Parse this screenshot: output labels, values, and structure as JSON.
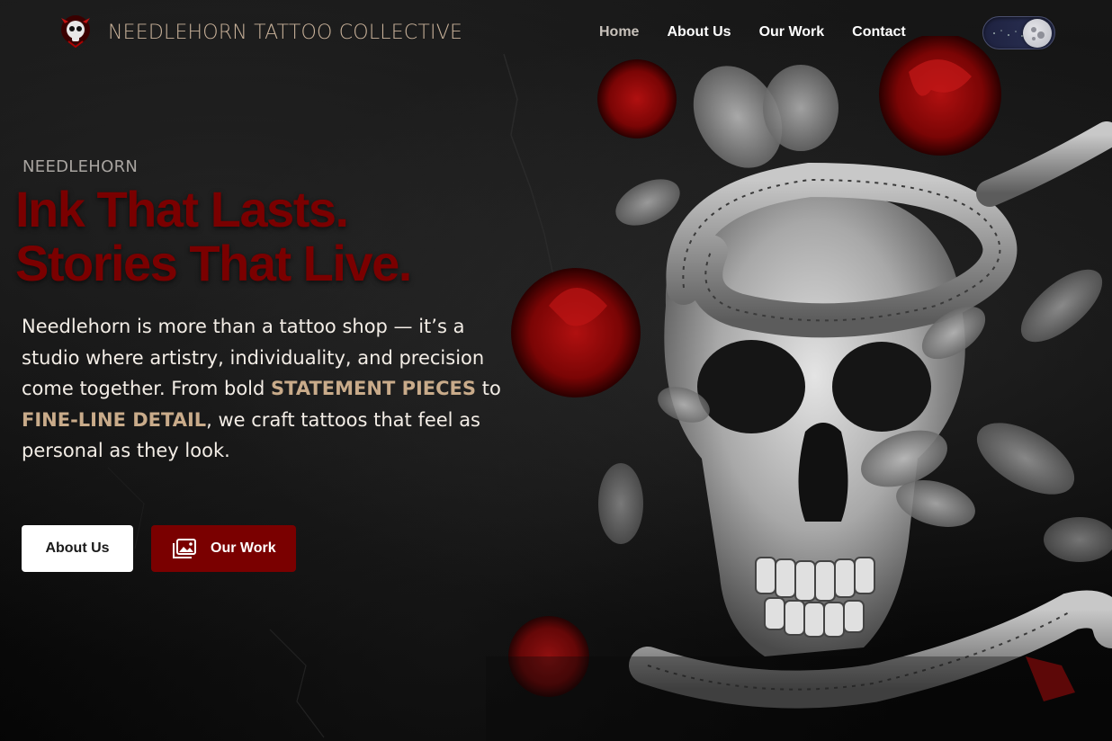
{
  "header": {
    "brand": "NEEDLEHORN TATTOO COLLECTIVE",
    "logo_icon": "skull-logo-icon",
    "nav": [
      {
        "label": "Home",
        "active": true
      },
      {
        "label": "About Us",
        "active": false
      },
      {
        "label": "Our Work",
        "active": false
      },
      {
        "label": "Contact",
        "active": false
      }
    ],
    "theme_toggle": {
      "state": "dark",
      "icon": "moon-icon"
    }
  },
  "hero": {
    "eyebrow": "NEEDLEHORN",
    "headline_line1": "Ink That Lasts.",
    "headline_line2": "Stories That Live.",
    "description": {
      "part1": "Needlehorn is more than a tattoo shop — it’s a studio where artistry, individuality, and precision come together. From bold ",
      "highlight1": "STATEMENT PIECES",
      "part2": " to ",
      "highlight2": "FINE-LINE DETAIL",
      "part3": ", we craft tattoos that feel as personal as they look."
    },
    "buttons": {
      "about_label": "About Us",
      "work_label": "Our Work",
      "work_icon": "image-gallery-icon"
    },
    "art_image": "skull-serpent-roses-illustration"
  },
  "colors": {
    "background": "#0a0a0a",
    "brand_text": "#c9b29a",
    "headline": "#7a0000",
    "highlight": "#c9ab8a",
    "primary_button": "#7a0000",
    "secondary_button": "#ffffff"
  }
}
